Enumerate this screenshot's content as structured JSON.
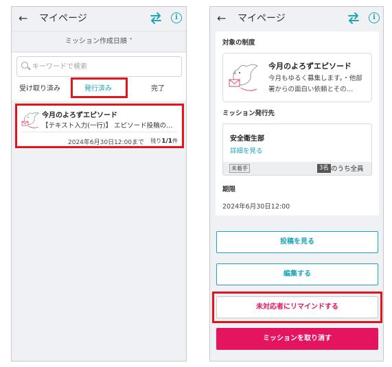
{
  "colors": {
    "accent": "#1aa6b7",
    "highlight": "#e4141b",
    "danger": "#e5145f"
  },
  "icons": {
    "back": "arrow-left-icon",
    "swap": "swap-arrows-icon",
    "info": "info-icon",
    "search": "search-icon",
    "thumbnail": "bird-letter-icon"
  },
  "left": {
    "header": {
      "back": "←",
      "title": "マイページ",
      "info": "i"
    },
    "sort": {
      "label": "ミッション作成日順 ˅"
    },
    "search": {
      "placeholder": "キーワードで検索"
    },
    "tabs": [
      {
        "label": "受け取り済み"
      },
      {
        "label": "発行済み"
      },
      {
        "label": "完了"
      }
    ],
    "mission": {
      "title": "今月のよろずエピソード",
      "subtitle": "【テキスト入力(一行)】 エピソード投稿の…",
      "deadline": "2024年6月30日12:00まで",
      "remaining_label": "残り",
      "remaining_value": "1/1",
      "remaining_unit": "件"
    }
  },
  "right": {
    "header": {
      "back": "←",
      "title": "マイページ",
      "info": "i"
    },
    "section_system": "対象の制度",
    "mission": {
      "title": "今月のよろずエピソード",
      "description": "今月もゆるく募集します。・他部署からの面白い依頼とその…"
    },
    "section_destination": "ミッション発行先",
    "destination": {
      "name": "安全衛生部",
      "link": "詳細を見る",
      "status": "未着手",
      "count": "3名",
      "of_all": "のうち全員"
    },
    "section_deadline": "期限",
    "deadline": "2024年6月30日12:00",
    "buttons": {
      "view_posts": "投稿を見る",
      "edit": "編集する",
      "remind": "未対応者にリマインドする",
      "cancel": "ミッションを取り消す"
    }
  }
}
